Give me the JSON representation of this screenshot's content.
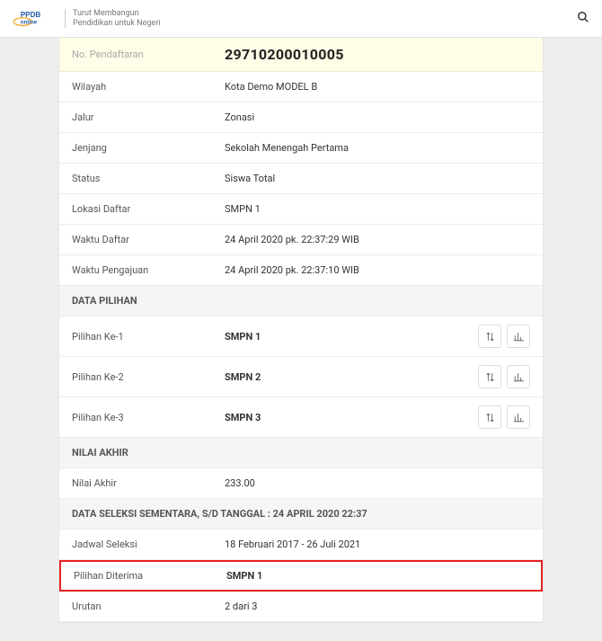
{
  "header": {
    "tagline_l1": "Turut Membangun",
    "tagline_l2": "Pendidikan untuk Negeri"
  },
  "rows": {
    "no_pendaftaran": {
      "label": "No. Pendaftaran",
      "value": "29710200010005"
    },
    "wilayah": {
      "label": "Wilayah",
      "value": "Kota Demo MODEL B"
    },
    "jalur": {
      "label": "Jalur",
      "value": "Zonasi"
    },
    "jenjang": {
      "label": "Jenjang",
      "value": "Sekolah Menengah Pertama"
    },
    "status": {
      "label": "Status",
      "value": "Siswa Total"
    },
    "lokasi": {
      "label": "Lokasi Daftar",
      "value": "SMPN 1"
    },
    "waktu_daftar": {
      "label": "Waktu Daftar",
      "value": "24 April 2020 pk. 22:37:29 WIB"
    },
    "waktu_pengajuan": {
      "label": "Waktu Pengajuan",
      "value": "24 April 2020 pk. 22:37:10 WIB"
    },
    "nilai_akhir": {
      "label": "Nilai Akhir",
      "value": "233.00"
    },
    "jadwal": {
      "label": "Jadwal Seleksi",
      "value": "18 Februari 2017 - 26 Juli 2021"
    },
    "diterima": {
      "label": "Pilihan Diterima",
      "value": "SMPN 1"
    },
    "urutan": {
      "label": "Urutan",
      "value": "2 dari 3"
    }
  },
  "sections": {
    "pilihan": "DATA PILIHAN",
    "nilai": "NILAI AKHIR",
    "seleksi": "DATA SELEKSI SEMENTARA, S/D TANGGAL : 24 APRIL 2020 22:37"
  },
  "pilihan": [
    {
      "label": "Pilihan Ke-1",
      "value": "SMPN 1"
    },
    {
      "label": "Pilihan Ke-2",
      "value": "SMPN 2"
    },
    {
      "label": "Pilihan Ke-3",
      "value": "SMPN 3"
    }
  ]
}
